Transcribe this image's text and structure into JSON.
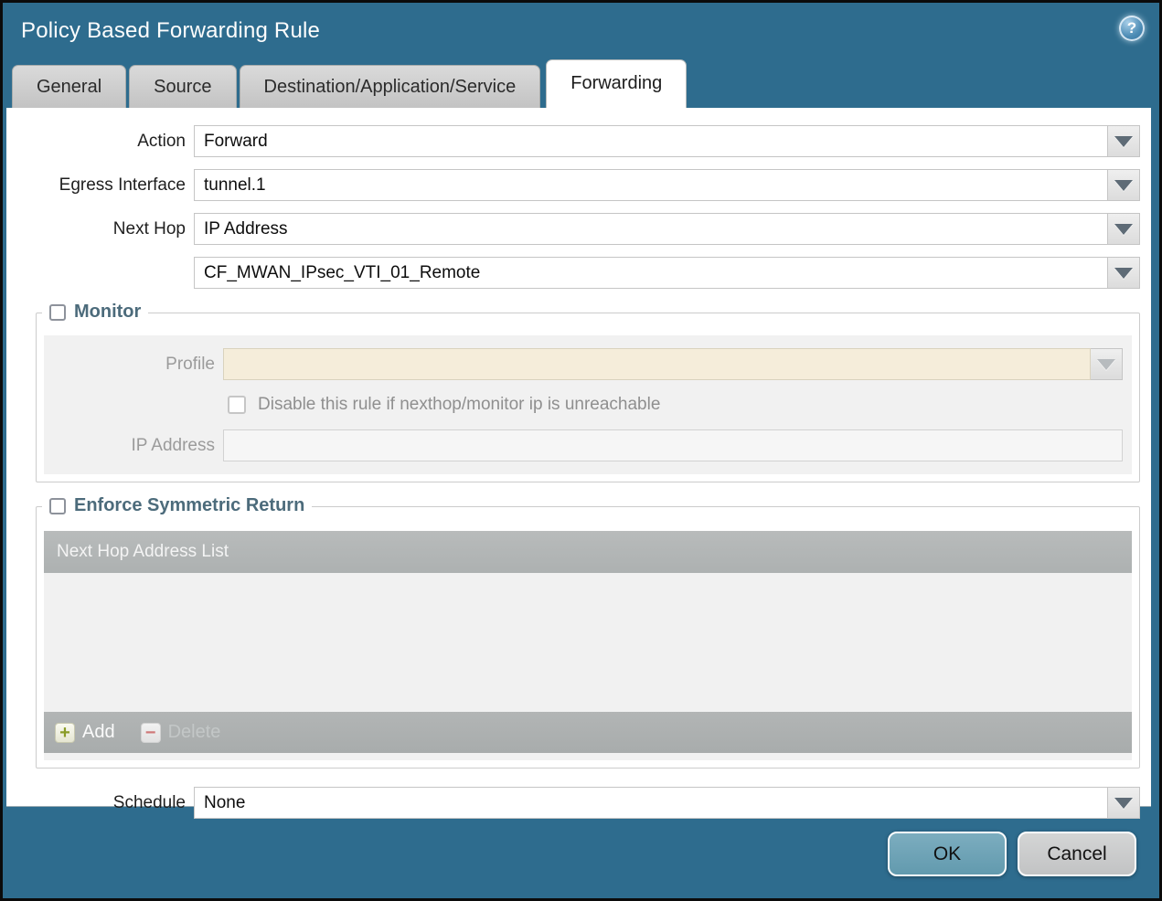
{
  "dialog": {
    "title": "Policy Based Forwarding Rule",
    "help_icon": "?"
  },
  "tabs": {
    "items": [
      {
        "label": "General",
        "active": false
      },
      {
        "label": "Source",
        "active": false
      },
      {
        "label": "Destination/Application/Service",
        "active": false
      },
      {
        "label": "Forwarding",
        "active": true
      }
    ]
  },
  "form": {
    "action": {
      "label": "Action",
      "value": "Forward"
    },
    "egress_interface": {
      "label": "Egress Interface",
      "value": "tunnel.1"
    },
    "next_hop": {
      "label": "Next Hop",
      "value": "IP Address"
    },
    "next_hop_address": {
      "value": "CF_MWAN_IPsec_VTI_01_Remote"
    },
    "schedule": {
      "label": "Schedule",
      "value": "None"
    }
  },
  "monitor": {
    "legend": "Monitor",
    "checked": false,
    "profile": {
      "label": "Profile",
      "value": ""
    },
    "disable_rule": {
      "label": "Disable this rule if nexthop/monitor ip is unreachable",
      "checked": false
    },
    "ip_address": {
      "label": "IP Address",
      "value": ""
    }
  },
  "symmetric_return": {
    "legend": "Enforce Symmetric Return",
    "checked": false,
    "table": {
      "header": "Next Hop Address List",
      "rows": []
    },
    "add_label": "Add",
    "delete_label": "Delete"
  },
  "footer": {
    "ok_label": "OK",
    "cancel_label": "Cancel"
  },
  "icons": {
    "help": "?",
    "add": "+",
    "delete": "−",
    "dropdown": "▼"
  },
  "colors": {
    "titlebar": "#2E6C8E",
    "ok_button": "#6AA2B6",
    "legend_text": "#4C6B7B",
    "disabled_field_beige": "#F5EDDA",
    "table_header_gray": "#B2B5B5"
  }
}
